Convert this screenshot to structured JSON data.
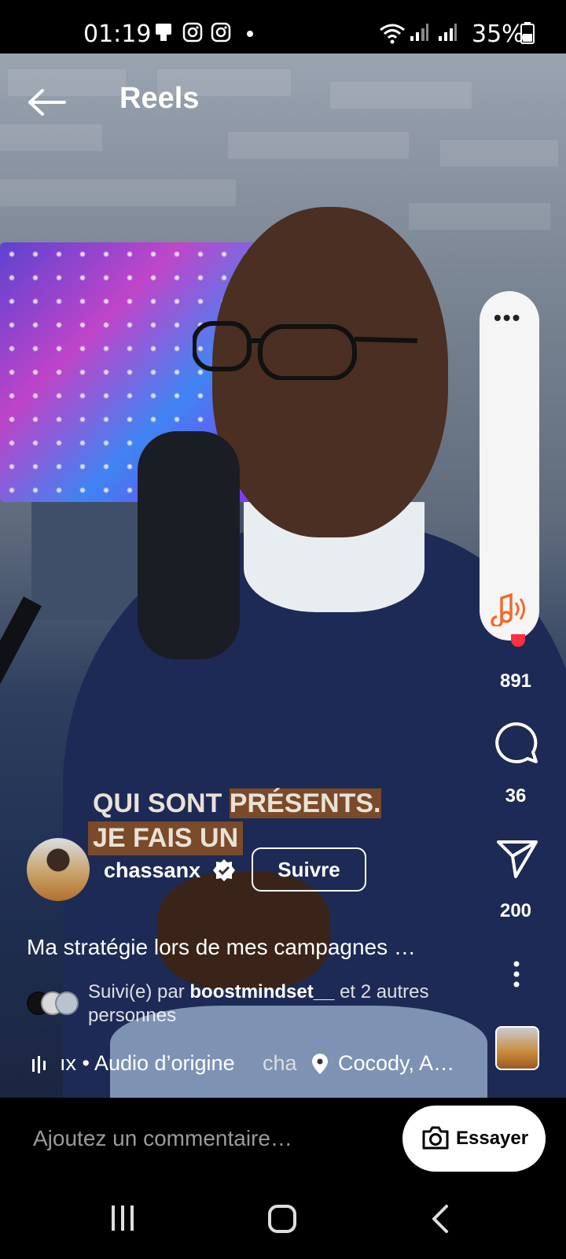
{
  "status_bar": {
    "time": "01:19",
    "battery": "35%",
    "icons": [
      "notification-icon",
      "instagram-icon",
      "instagram-icon",
      "dot-icon",
      "wifi-icon",
      "signal-icon",
      "signal-icon",
      "battery-icon"
    ]
  },
  "header": {
    "title": "Reels"
  },
  "sound_panel": {
    "more": "•••"
  },
  "actions": {
    "likes": "891",
    "comments": "36",
    "shares": "200"
  },
  "video_text": {
    "line1_a": "QUI SONT ",
    "line1_b": "PRÉSENTS.",
    "line2": "JE FAIS UN"
  },
  "author": {
    "username": "chassanx",
    "follow_label": "Suivre"
  },
  "caption": "Ma stratégie lors de mes campagnes …",
  "followed_by": {
    "prefix": "Suivi(e) par ",
    "user": "boostmindset__",
    "suffix": " et 2 autres personnes"
  },
  "audio": {
    "label": "ıx • Audio d’origine",
    "user_short": "cha",
    "location": "Cocody, A…"
  },
  "comment_bar": {
    "placeholder": "Ajoutez un commentaire…",
    "try_label": "Essayer"
  },
  "colors": {
    "accent_red": "#ff3040",
    "sound_note": "#f26a2e"
  }
}
